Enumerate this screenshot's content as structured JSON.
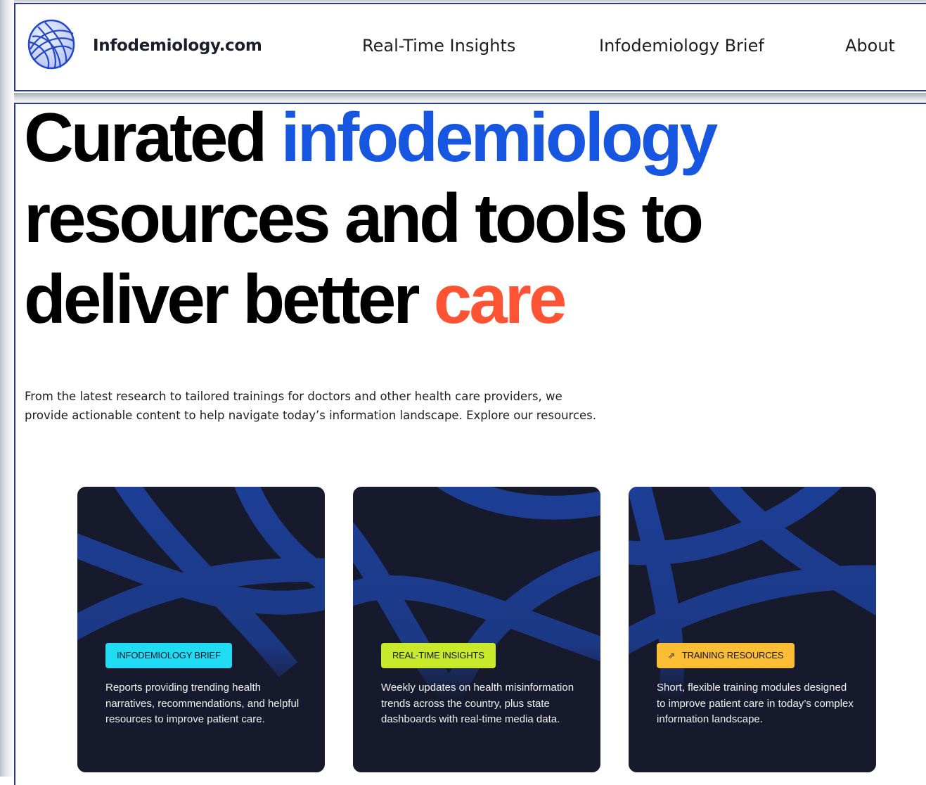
{
  "header": {
    "brand": "Infodemiology.com",
    "nav": [
      {
        "label": "Real-Time Insights"
      },
      {
        "label": "Infodemiology Brief"
      },
      {
        "label": "About"
      }
    ]
  },
  "hero": {
    "word1": "Curated",
    "word2_highlight": "infodemiology",
    "line2": "resources and tools to",
    "line3_start": "deliver better",
    "line3_highlight": "care",
    "intro_line1": "From the latest research to tailored trainings for doctors and other health care providers, we",
    "intro_line2": "provide actionable content to help navigate today’s information landscape. Explore our resources."
  },
  "cards": [
    {
      "badge": "INFODEMIOLOGY BRIEF",
      "description": "Reports providing trending health narratives, recommendations, and helpful resources to improve patient care."
    },
    {
      "badge": "REAL-TIME INSIGHTS",
      "description": "Weekly updates on health misinformation trends across the country, plus state dashboards with real-time media data."
    },
    {
      "badge": "TRAINING RESOURCES",
      "badge_icon": "external-link-icon",
      "description": "Short, flexible training modules designed to improve patient care in today’s complex information landscape."
    }
  ],
  "colors": {
    "accent_blue": "#1756e0",
    "accent_orange": "#ff5433",
    "card_bg": "#171a2c",
    "badge_cyan": "#1fdcf3",
    "badge_lime": "#c8ea2a",
    "badge_amber": "#fbbd34",
    "frame_border": "#2b3e85"
  }
}
